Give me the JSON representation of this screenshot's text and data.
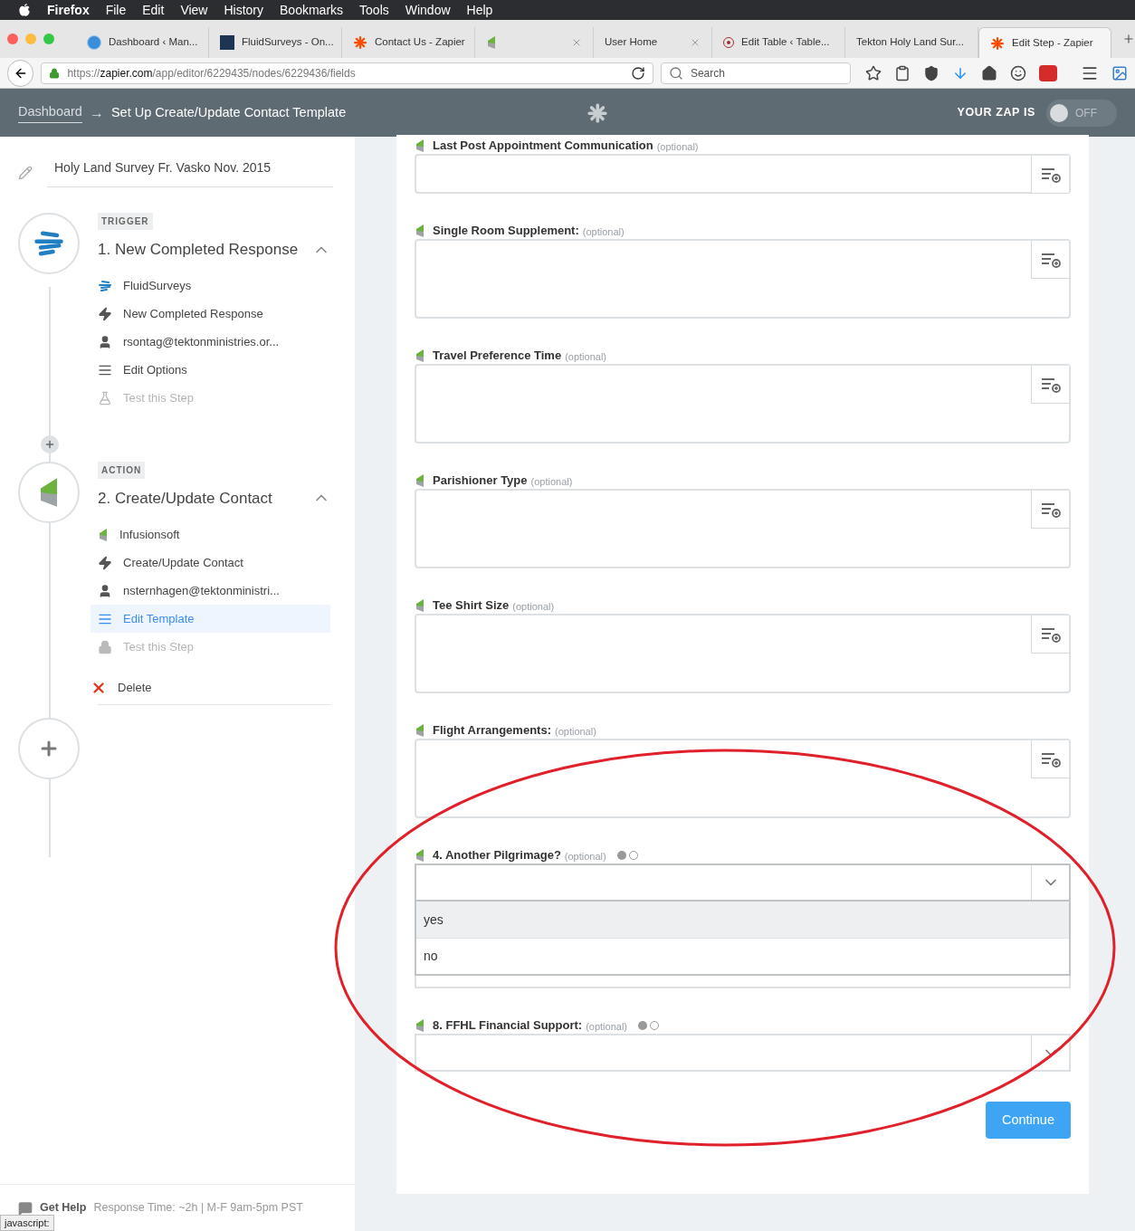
{
  "menu_bar": {
    "app": "Firefox",
    "items": [
      "File",
      "Edit",
      "View",
      "History",
      "Bookmarks",
      "Tools",
      "Window",
      "Help"
    ]
  },
  "tabs": [
    {
      "title": "Dashboard ‹ Man...",
      "kind": "globe",
      "selected": false
    },
    {
      "title": "FluidSurveys - On...",
      "kind": "fs",
      "selected": false
    },
    {
      "title": "Contact Us - Zapier",
      "kind": "zapier",
      "selected": false
    },
    {
      "kind": "infusionsoft",
      "selected": false
    },
    {
      "title": "User Home",
      "kind": "plain",
      "selected": false
    },
    {
      "title": "Edit Table ‹ Table...",
      "kind": "target",
      "selected": false
    },
    {
      "title": "Tekton Holy Land Sur...",
      "kind": "plain",
      "selected": false
    },
    {
      "title": "Edit Step - Zapier",
      "kind": "zapier",
      "selected": true
    }
  ],
  "address_bar": {
    "url_prefix": "https://",
    "url_host": "zapier.com",
    "url_path": "/app/editor/6229435/nodes/6229436/fields",
    "search_placeholder": "Search"
  },
  "header": {
    "breadcrumb_link": "Dashboard",
    "arrow": "→",
    "title": "Set Up Create/Update Contact Template",
    "zap_label": "YOUR ZAP IS",
    "zap_state": "OFF",
    "on": false
  },
  "sidebar": {
    "zap_name": "Holy Land Survey Fr. Vasko Nov. 2015",
    "steps": [
      {
        "badge": "TRIGGER",
        "title": "1. New Completed Response",
        "kind": "fluid",
        "expanded": true,
        "items": [
          {
            "kind": "fluid",
            "label": "FluidSurveys",
            "selected": false,
            "disabled": false
          },
          {
            "kind": "bolt",
            "label": "New Completed Response",
            "selected": false,
            "disabled": false
          },
          {
            "kind": "user",
            "label": "rsontag@tektonministries.or...",
            "selected": false,
            "disabled": false
          },
          {
            "kind": "list",
            "label": "Edit Options",
            "selected": false,
            "disabled": false
          },
          {
            "kind": "flask",
            "label": "Test this Step",
            "selected": false,
            "disabled": true
          }
        ]
      },
      {
        "badge": "ACTION",
        "title": "2. Create/Update Contact",
        "kind": "infusionsoft",
        "expanded": true,
        "items": [
          {
            "kind": "infusionsoft",
            "label": "Infusionsoft",
            "selected": false,
            "disabled": false
          },
          {
            "kind": "bolt",
            "label": "Create/Update Contact",
            "selected": false,
            "disabled": false
          },
          {
            "kind": "user",
            "label": "nsternhagen@tektonministri...",
            "selected": false,
            "disabled": false
          },
          {
            "kind": "list",
            "label": "Edit Template",
            "selected": true,
            "disabled": false
          },
          {
            "kind": "lock",
            "label": "Test this Step",
            "selected": false,
            "disabled": true
          }
        ],
        "delete": "Delete"
      }
    ],
    "help": {
      "label": "Get Help",
      "info": "Response Time: ~2h | M-F 9am-5pm PST"
    }
  },
  "fields": [
    {
      "kind": "short",
      "label": "Last Post Appointment Communication",
      "optional": "(optional)"
    },
    {
      "kind": "text",
      "label": "Single Room Supplement:",
      "optional": "(optional)"
    },
    {
      "kind": "text",
      "label": "Travel Preference Time",
      "optional": "(optional)"
    },
    {
      "kind": "text",
      "label": "Parishioner Type",
      "optional": "(optional)"
    },
    {
      "kind": "text",
      "label": "Tee Shirt Size",
      "optional": "(optional)"
    },
    {
      "kind": "text",
      "label": "Flight Arrangements:",
      "optional": "(optional)"
    },
    {
      "kind": "dropdown",
      "label": "4. Another Pilgrimage?",
      "optional": "(optional)",
      "expanded": true,
      "options": [
        {
          "label": "yes",
          "selected": true
        },
        {
          "label": "no",
          "selected": false
        }
      ]
    },
    {
      "kind": "dropdown",
      "label": "8. FFHL Financial Support:",
      "optional": "(optional)",
      "expanded": false
    }
  ],
  "continue_button": "Continue",
  "status_text": "javascript:"
}
